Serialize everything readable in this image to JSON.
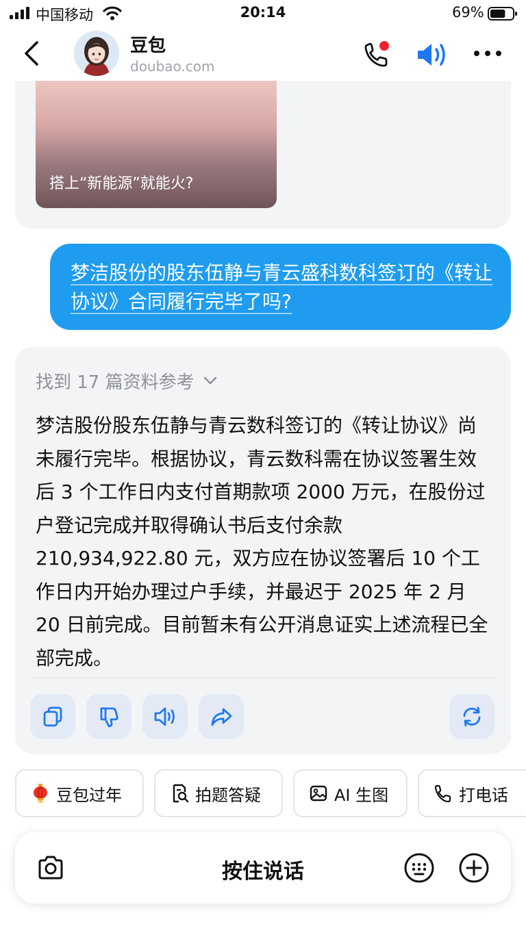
{
  "status_bar": {
    "carrier": "中国移动",
    "time": "20:14",
    "battery_percent": "69%",
    "battery_level": 0.69
  },
  "header": {
    "title": "豆包",
    "subtitle": "doubao.com"
  },
  "chat": {
    "previous_card_caption": "搭上“新能源”就能火?",
    "user_message": "梦洁股份的股东伍静与青云盛科数科签订的《转让协议》合同履行完毕了吗?",
    "references_label": "找到 17 篇资料参考",
    "reply_text": "梦洁股份股东伍静与青云数科签订的《转让协议》尚未履行完毕。根据协议，青云数科需在协议签署生效后 3 个工作日内支付首期款项 2000 万元，在股份过户登记完成并取得确认书后支付余款 210,934,922.80 元，双方应在协议签署后 10 个工作日内开始办理过户手续，并最迟于 2025 年 2 月 20 日前完成。目前暂未有公开消息证实上述流程已全部完成。"
  },
  "suggestions": [
    {
      "label": "豆包过年",
      "icon": "lantern-icon"
    },
    {
      "label": "拍题答疑",
      "icon": "document-search-icon"
    },
    {
      "label": "AI 生图",
      "icon": "image-icon"
    },
    {
      "label": "打电话",
      "icon": "phone-icon"
    }
  ],
  "input": {
    "hold_to_talk_label": "按住说话"
  },
  "colors": {
    "accent": "#1f9cf0",
    "bubble_bg": "#f3f4f6",
    "icon_blue": "#1f78f0"
  }
}
